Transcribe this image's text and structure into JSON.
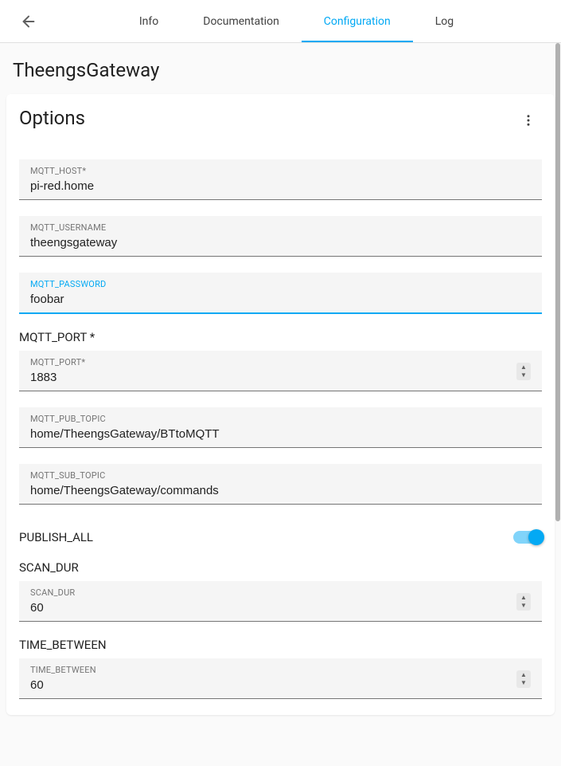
{
  "tabs": {
    "info": "Info",
    "documentation": "Documentation",
    "configuration": "Configuration",
    "log": "Log"
  },
  "page_title": "TheengsGateway",
  "card": {
    "title": "Options"
  },
  "fields": {
    "mqtt_host": {
      "label": "MQTT_HOST*",
      "value": "pi-red.home"
    },
    "mqtt_username": {
      "label": "MQTT_USERNAME",
      "value": "theengsgateway"
    },
    "mqtt_password": {
      "label": "MQTT_PASSWORD",
      "value": "foobar"
    },
    "mqtt_port": {
      "outer": "MQTT_PORT *",
      "label": "MQTT_PORT*",
      "value": "1883"
    },
    "mqtt_pub_topic": {
      "label": "MQTT_PUB_TOPIC",
      "value": "home/TheengsGateway/BTtoMQTT"
    },
    "mqtt_sub_topic": {
      "label": "MQTT_SUB_TOPIC",
      "value": "home/TheengsGateway/commands"
    },
    "publish_all": {
      "label": "PUBLISH_ALL",
      "value": true
    },
    "scan_dur": {
      "outer": "SCAN_DUR",
      "label": "SCAN_DUR",
      "value": "60"
    },
    "time_between": {
      "outer": "TIME_BETWEEN",
      "label": "TIME_BETWEEN",
      "value": "60"
    }
  }
}
